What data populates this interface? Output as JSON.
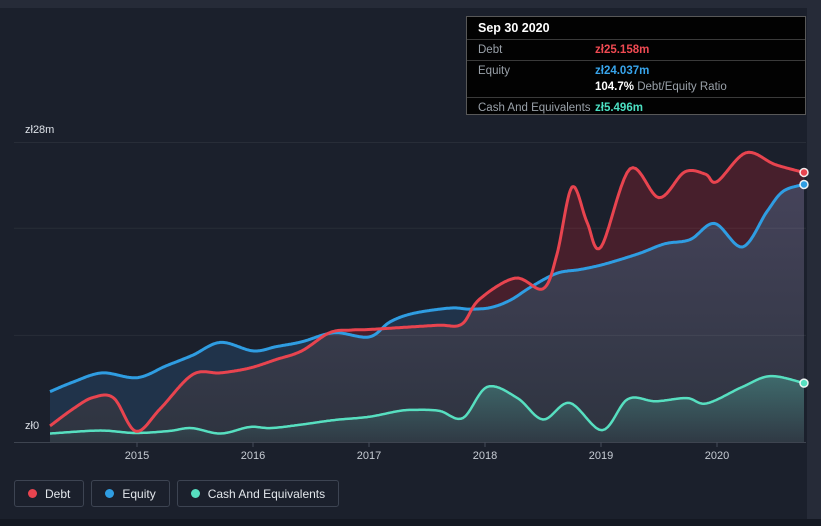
{
  "tooltip": {
    "date": "Sep 30 2020",
    "debt_label": "Debt",
    "debt_value": "zł25.158m",
    "equity_label": "Equity",
    "equity_value": "zł24.037m",
    "ratio_value": "104.7%",
    "ratio_label": "Debt/Equity Ratio",
    "cash_label": "Cash And Equivalents",
    "cash_value": "zł5.496m"
  },
  "legend": {
    "items": [
      {
        "label": "Debt",
        "color": "#e8444f"
      },
      {
        "label": "Equity",
        "color": "#2f9de2"
      },
      {
        "label": "Cash And Equivalents",
        "color": "#57dfc0"
      }
    ]
  },
  "chart_data": {
    "type": "area",
    "x_range": [
      2014.25,
      2020.75
    ],
    "ylim": [
      0,
      28
    ],
    "x_axis": {
      "ticks": [
        2015,
        2016,
        2017,
        2018,
        2019,
        2020
      ]
    },
    "y_axis": {
      "top_label": "zł28m",
      "zero_label": "zł0",
      "gridline_values": [
        0,
        10,
        20,
        28
      ],
      "unit": "zł millions"
    },
    "colors": {
      "debt_line": "#e8444f",
      "equity_line": "#2f9de2",
      "cash_line": "#57dfc0",
      "debt_over_equity_fill": "#471f2c",
      "equity_over_debt_fill": "#20334a",
      "base_fill_top": "#45435a",
      "base_fill_bottom": "#2e3440",
      "cash_fill_top": "rgba(87,223,194,0.30)",
      "cash_fill_bottom": "rgba(87,223,194,0.03)",
      "gridline": "rgba(255,255,255,0.06)",
      "baseline": "#3e4450",
      "tick": "#464d5a",
      "tick_label": "#c7ccd4"
    },
    "series": [
      {
        "name": "Debt",
        "points": [
          [
            2014.25,
            1.5
          ],
          [
            2014.45,
            3.1
          ],
          [
            2014.62,
            4.15
          ],
          [
            2014.8,
            4.1
          ],
          [
            2014.99,
            1.0
          ],
          [
            2015.2,
            3.1
          ],
          [
            2015.48,
            6.3
          ],
          [
            2015.72,
            6.45
          ],
          [
            2015.97,
            6.9
          ],
          [
            2016.2,
            7.7
          ],
          [
            2016.42,
            8.5
          ],
          [
            2016.66,
            10.2
          ],
          [
            2016.85,
            10.45
          ],
          [
            2017.0,
            10.5
          ],
          [
            2017.3,
            10.7
          ],
          [
            2017.6,
            10.9
          ],
          [
            2017.8,
            11.0
          ],
          [
            2017.95,
            13.3
          ],
          [
            2018.26,
            15.3
          ],
          [
            2018.5,
            14.3
          ],
          [
            2018.62,
            17.5
          ],
          [
            2018.75,
            23.8
          ],
          [
            2018.88,
            20.5
          ],
          [
            2019.0,
            18.2
          ],
          [
            2019.25,
            25.5
          ],
          [
            2019.5,
            22.8
          ],
          [
            2019.72,
            25.2
          ],
          [
            2019.9,
            25.0
          ],
          [
            2020.0,
            24.3
          ],
          [
            2020.25,
            27.0
          ],
          [
            2020.5,
            25.9
          ],
          [
            2020.75,
            25.158
          ]
        ]
      },
      {
        "name": "Equity",
        "points": [
          [
            2014.25,
            4.7
          ],
          [
            2014.45,
            5.6
          ],
          [
            2014.7,
            6.45
          ],
          [
            2015.0,
            6.0
          ],
          [
            2015.25,
            7.1
          ],
          [
            2015.48,
            8.1
          ],
          [
            2015.72,
            9.3
          ],
          [
            2016.0,
            8.5
          ],
          [
            2016.2,
            8.9
          ],
          [
            2016.42,
            9.35
          ],
          [
            2016.7,
            10.2
          ],
          [
            2017.0,
            9.8
          ],
          [
            2017.18,
            11.2
          ],
          [
            2017.38,
            12.0
          ],
          [
            2017.7,
            12.5
          ],
          [
            2017.87,
            12.4
          ],
          [
            2018.05,
            12.55
          ],
          [
            2018.22,
            13.25
          ],
          [
            2018.4,
            14.5
          ],
          [
            2018.62,
            15.75
          ],
          [
            2018.82,
            16.1
          ],
          [
            2019.03,
            16.6
          ],
          [
            2019.33,
            17.6
          ],
          [
            2019.55,
            18.5
          ],
          [
            2019.77,
            18.9
          ],
          [
            2019.98,
            20.4
          ],
          [
            2020.22,
            18.2
          ],
          [
            2020.43,
            21.5
          ],
          [
            2020.57,
            23.4
          ],
          [
            2020.75,
            24.037
          ]
        ]
      },
      {
        "name": "Cash And Equivalents",
        "points": [
          [
            2014.25,
            0.79
          ],
          [
            2014.68,
            1.07
          ],
          [
            2014.98,
            0.84
          ],
          [
            2015.28,
            1.03
          ],
          [
            2015.47,
            1.3
          ],
          [
            2015.72,
            0.79
          ],
          [
            2015.97,
            1.4
          ],
          [
            2016.15,
            1.3
          ],
          [
            2016.4,
            1.6
          ],
          [
            2016.7,
            2.05
          ],
          [
            2017.0,
            2.35
          ],
          [
            2017.26,
            2.9
          ],
          [
            2017.41,
            3.0
          ],
          [
            2017.61,
            2.9
          ],
          [
            2017.81,
            2.24
          ],
          [
            2018.02,
            5.15
          ],
          [
            2018.28,
            4.1
          ],
          [
            2018.5,
            2.1
          ],
          [
            2018.73,
            3.65
          ],
          [
            2019.01,
            1.1
          ],
          [
            2019.23,
            4.0
          ],
          [
            2019.47,
            3.8
          ],
          [
            2019.74,
            4.1
          ],
          [
            2019.91,
            3.6
          ],
          [
            2020.22,
            5.15
          ],
          [
            2020.46,
            6.15
          ],
          [
            2020.75,
            5.496
          ]
        ]
      }
    ]
  }
}
